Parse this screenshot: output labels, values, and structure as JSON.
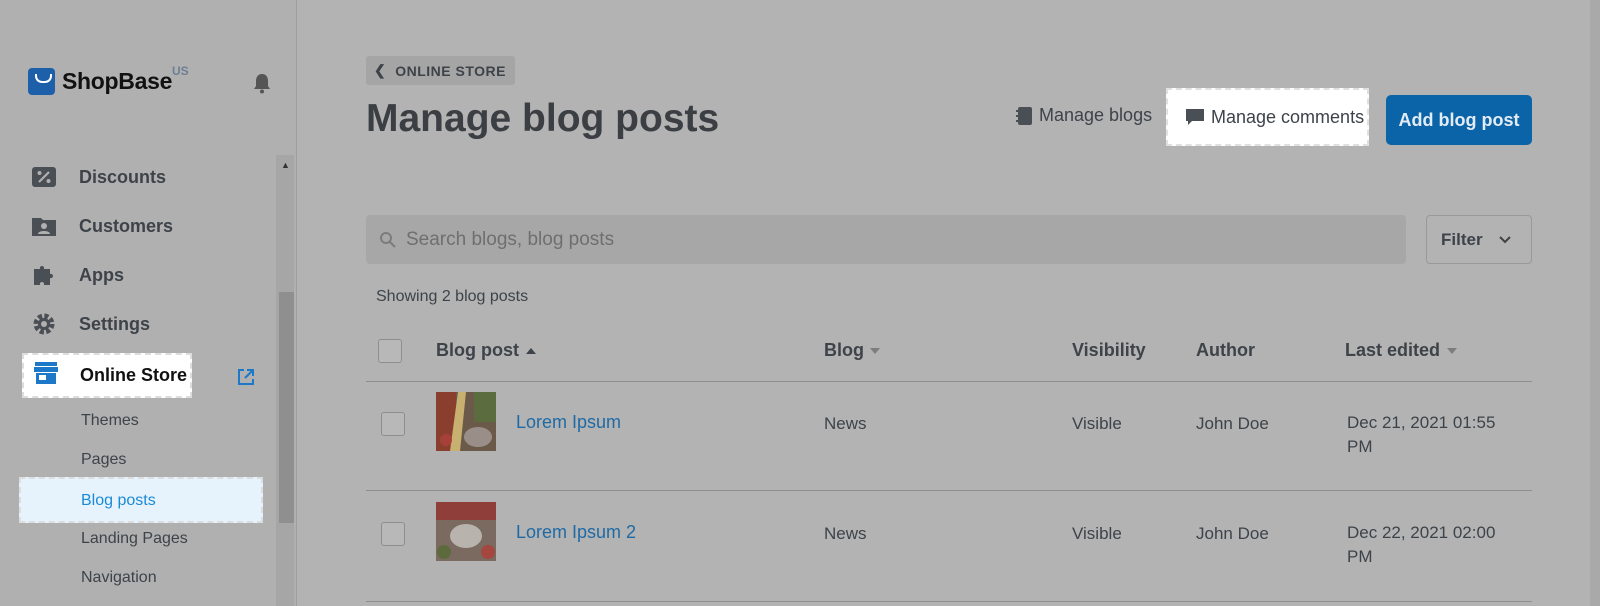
{
  "brand": {
    "name": "ShopBase",
    "region": "US"
  },
  "sidebar": {
    "items": [
      {
        "label": "Discounts"
      },
      {
        "label": "Customers"
      },
      {
        "label": "Apps"
      },
      {
        "label": "Settings"
      },
      {
        "label": "Online Store"
      }
    ],
    "sub_items": [
      {
        "label": "Themes"
      },
      {
        "label": "Pages"
      },
      {
        "label": "Blog posts"
      },
      {
        "label": "Landing Pages"
      },
      {
        "label": "Navigation"
      }
    ]
  },
  "header": {
    "breadcrumb": "ONLINE STORE",
    "title": "Manage blog posts",
    "manage_blogs": "Manage blogs",
    "manage_comments": "Manage comments",
    "add_post": "Add blog post"
  },
  "search": {
    "placeholder": "Search blogs, blog posts"
  },
  "filter": {
    "label": "Filter"
  },
  "showing": "Showing 2 blog posts",
  "table": {
    "columns": [
      "Blog post",
      "Blog",
      "Visibility",
      "Author",
      "Last edited"
    ],
    "rows": [
      {
        "title": "Lorem Ipsum",
        "blog": "News",
        "visibility": "Visible",
        "author": "John Doe",
        "last_edited": "Dec 21, 2021 01:55 PM"
      },
      {
        "title": "Lorem Ipsum 2",
        "blog": "News",
        "visibility": "Visible",
        "author": "John Doe",
        "last_edited": "Dec 22, 2021 02:00 PM"
      }
    ]
  },
  "colors": {
    "primary": "#0b64a7",
    "link": "#1f6aa5",
    "active_sub": "#1b8ad6"
  }
}
